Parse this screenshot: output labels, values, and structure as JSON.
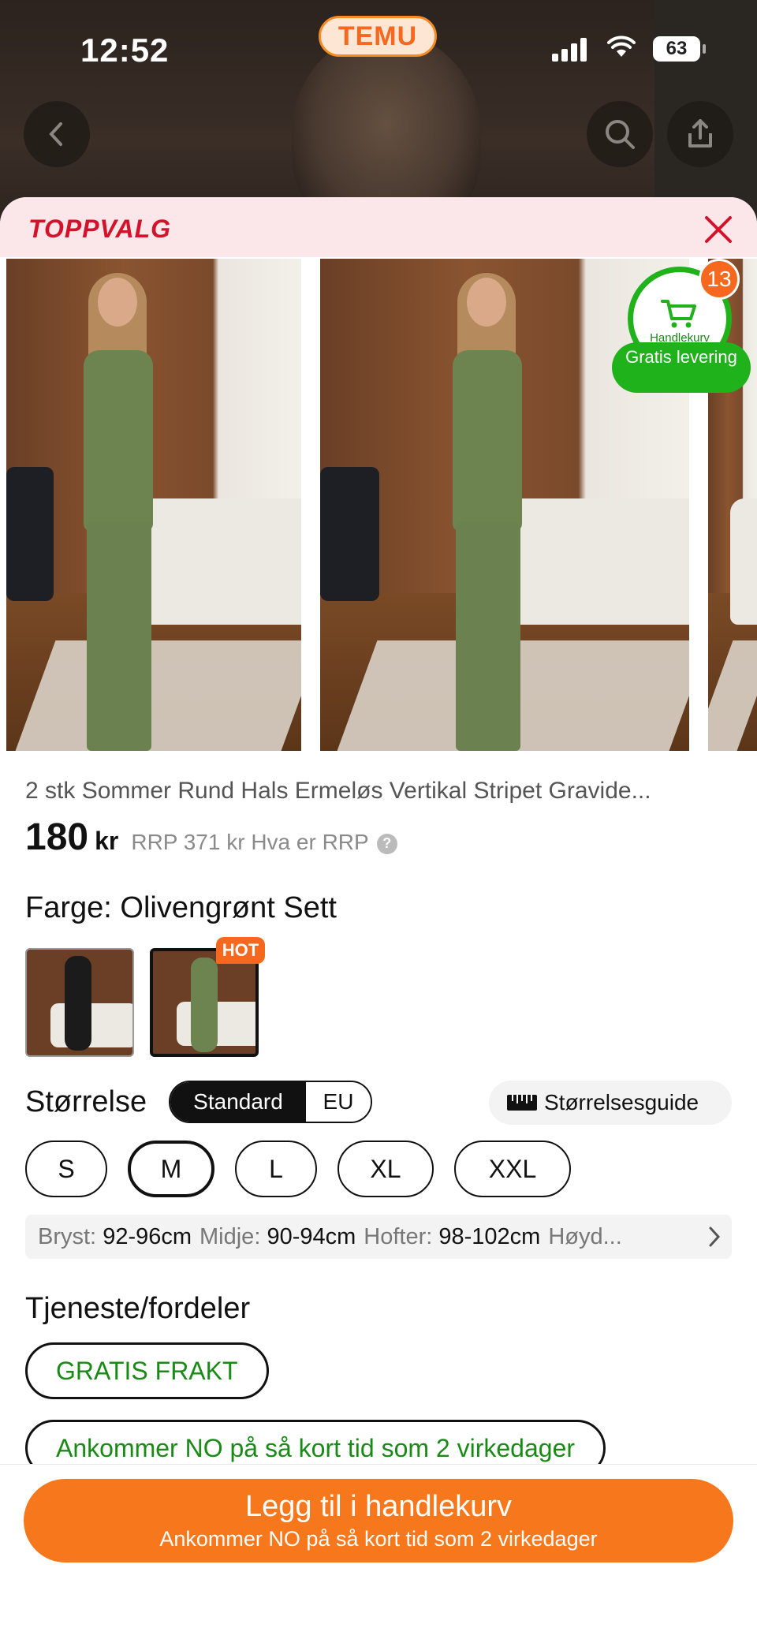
{
  "status_bar": {
    "time": "12:52",
    "battery": "63"
  },
  "app": {
    "brand": "TEMU"
  },
  "sheet": {
    "badge_label": "TOPPVALG"
  },
  "cart": {
    "count": "13",
    "label": "Handlekurv",
    "free_delivery": "Gratis levering"
  },
  "product": {
    "title": "2 stk Sommer Rund Hals Ermeløs Vertikal Stripet Gravide...",
    "price": "180",
    "currency": "kr",
    "rrp_text": "RRP 371 kr Hva er RRP",
    "help_icon_glyph": "?"
  },
  "color": {
    "label": "Farge: Olivengrønt Sett",
    "hot_tag": "HOT",
    "swatches": [
      {
        "name": "Svart",
        "color": "#1b1b1b"
      },
      {
        "name": "Olivengrønt",
        "color": "#6e8450"
      }
    ]
  },
  "size": {
    "label": "Størrelse",
    "toggle": [
      "Standard",
      "EU"
    ],
    "guide_label": "Størrelsesguide",
    "options": [
      "S",
      "M",
      "L",
      "XL",
      "XXL"
    ],
    "selected": "M",
    "measurements": [
      {
        "k": "Bryst:",
        "v": "92-96cm"
      },
      {
        "k": "Midje:",
        "v": "90-94cm"
      },
      {
        "k": "Hofter:",
        "v": "98-102cm"
      },
      {
        "k": "Høyd...",
        "v": ""
      }
    ]
  },
  "services": {
    "label": "Tjeneste/fordeler",
    "items": [
      "GRATIS FRAKT",
      "Ankommer NO på så kort tid som 2 virkedager"
    ]
  },
  "cta": {
    "main": "Legg til i handlekurv",
    "sub": "Ankommer NO på så kort tid som 2 virkedager"
  },
  "colors": {
    "accent": "#f7781c",
    "green": "#1fb21a",
    "red": "#d3132b"
  }
}
